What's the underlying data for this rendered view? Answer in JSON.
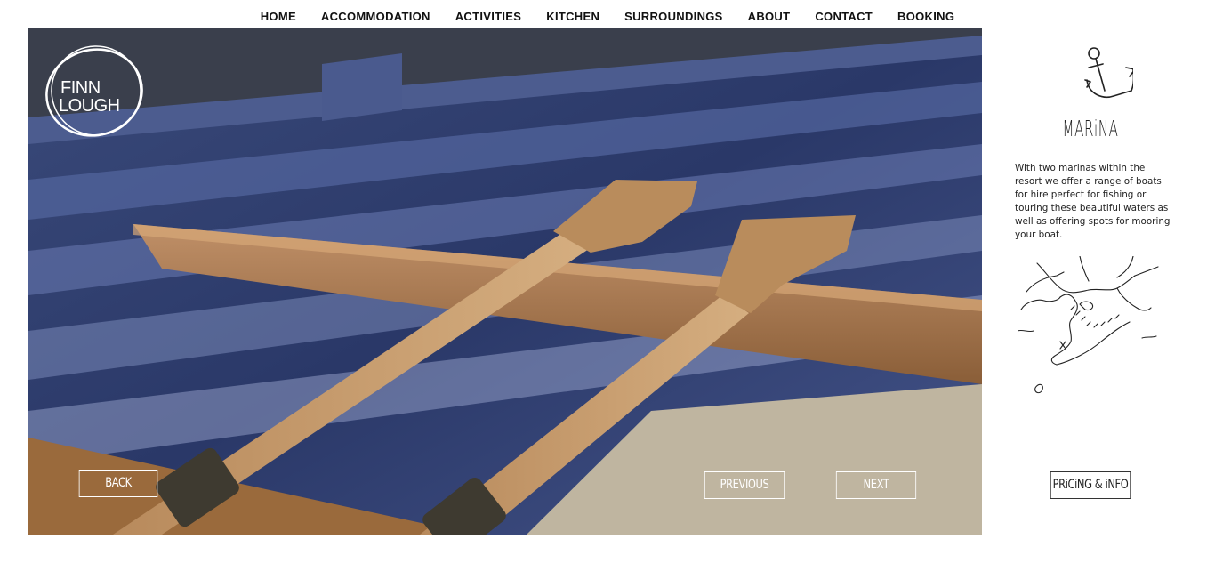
{
  "nav": {
    "items": [
      {
        "label": "HOME"
      },
      {
        "label": "ACCOMMODATION"
      },
      {
        "label": "ACTIVITIES"
      },
      {
        "label": "KITCHEN"
      },
      {
        "label": "SURROUNDINGS"
      },
      {
        "label": "ABOUT"
      },
      {
        "label": "CONTACT"
      },
      {
        "label": "BOOKING"
      }
    ]
  },
  "logo": {
    "line1": "FINN",
    "line2": "LOUGH"
  },
  "hero": {
    "back_label": "BACK",
    "previous_label": "PREVIOUS",
    "next_label": "NEXT"
  },
  "side": {
    "icon": "anchor-icon",
    "title": "MARiNA",
    "description": "With two marinas within the resort we offer a range of boats for hire perfect for fishing or touring these beautiful waters as well as offering spots for mooring your boat.",
    "map_icon": "marina-map-icon",
    "pricing_label": "PRiCiNG & iNFO"
  },
  "colors": {
    "hull_blue": "#2d3c6b",
    "wood": "#a87a4e",
    "text": "#111111",
    "background": "#ffffff"
  }
}
